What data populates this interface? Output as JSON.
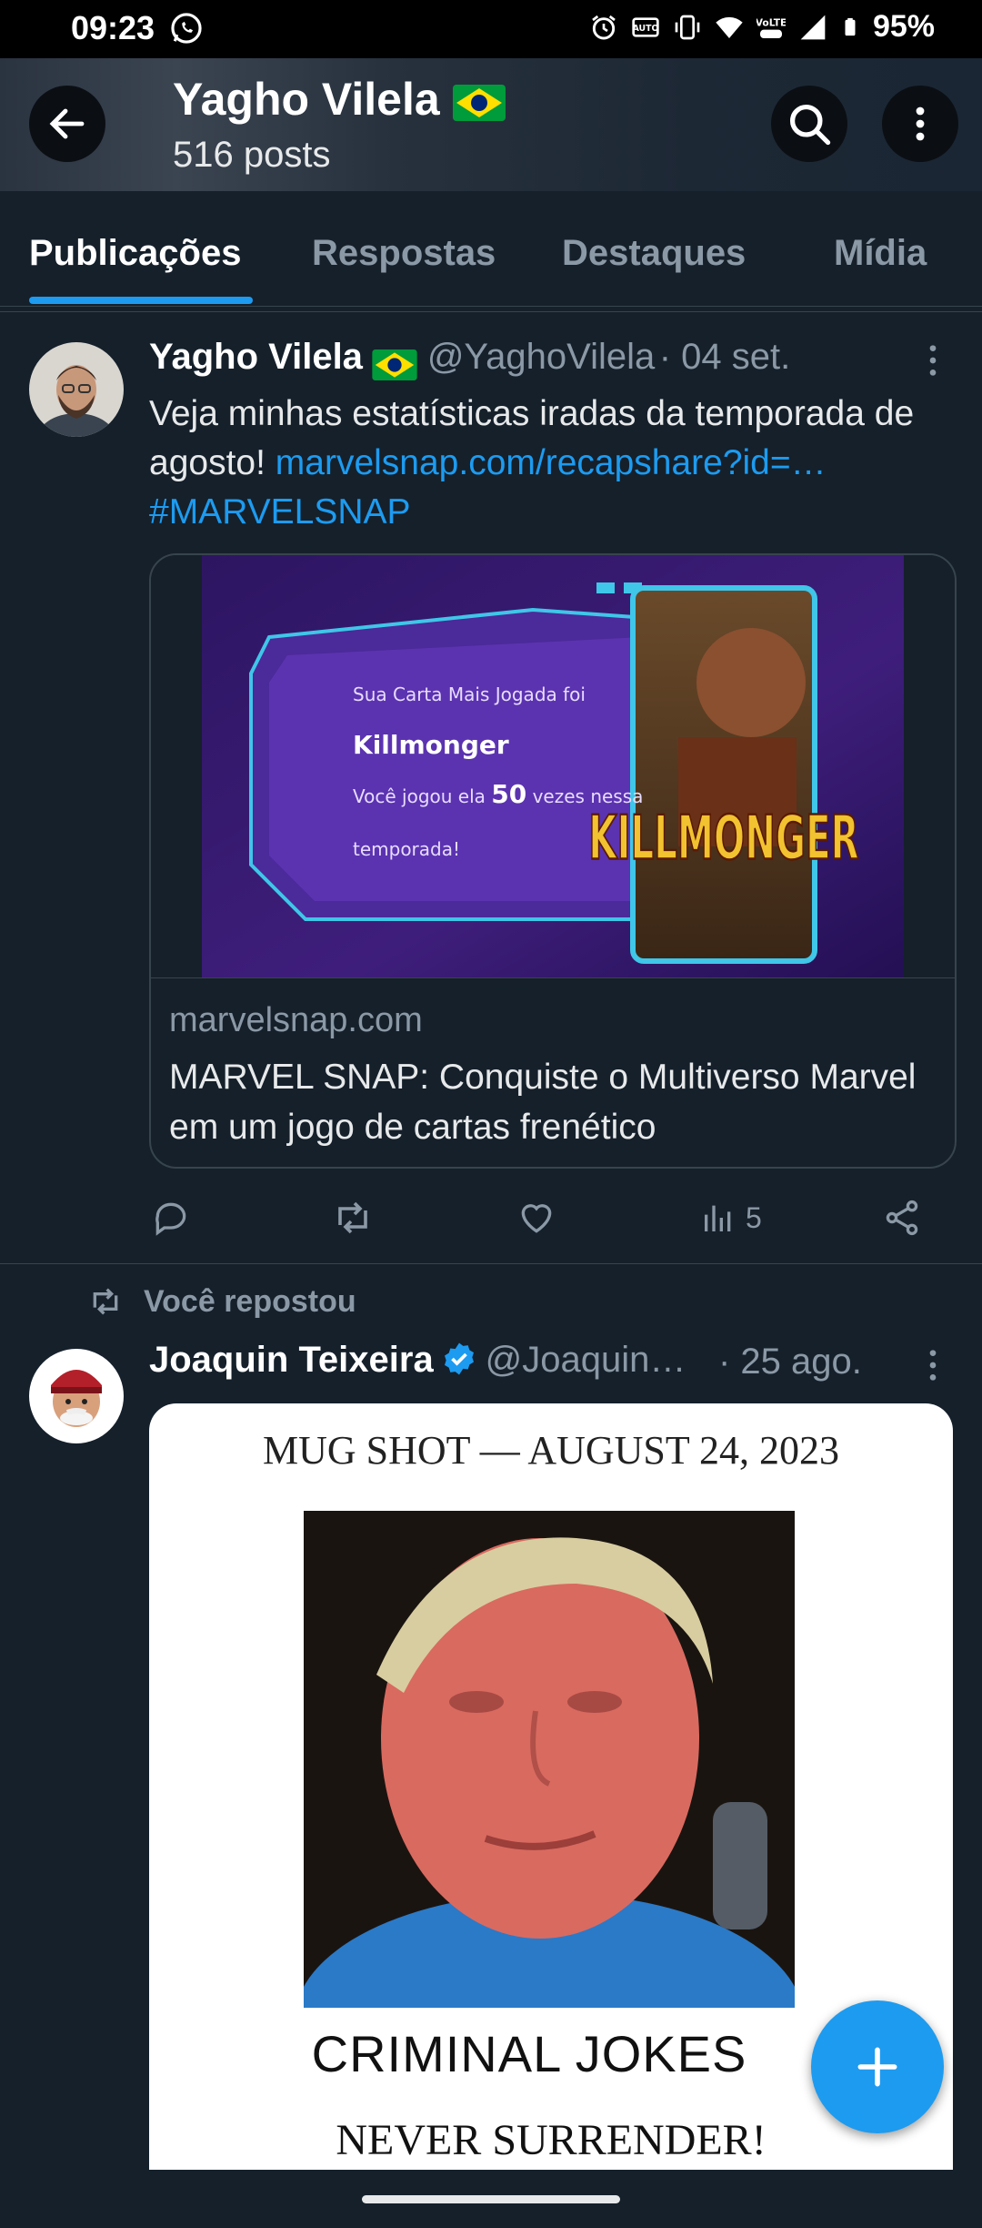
{
  "status_bar": {
    "time": "09:23",
    "battery": "95%"
  },
  "header": {
    "name": "Yagho Vilela",
    "posts": "516 posts"
  },
  "tabs": [
    {
      "label": "Publicações"
    },
    {
      "label": "Respostas"
    },
    {
      "label": "Destaques"
    },
    {
      "label": "Mídia"
    }
  ],
  "post1": {
    "name": "Yagho Vilela",
    "handle": "@YaghoVilela",
    "date": "· 04 set.",
    "text": "Veja minhas estatísticas iradas da temporada de agosto! ",
    "link": "marvelsnap.com/recapshare?id=…",
    "hashtag": "#MARVELSNAP",
    "card": {
      "line1": "Sua Carta Mais Jogada foi",
      "card_name": "Killmonger",
      "line2a": "Você jogou ela ",
      "count": "50",
      "line2b": " vezes nessa",
      "line3": "temporada!",
      "art_title": "KILLMONGER",
      "domain": "marvelsnap.com",
      "title": "MARVEL SNAP: Conquiste o Multiverso Marvel em um jogo de cartas frenético"
    },
    "views": "5"
  },
  "repost_label": "Você repostou",
  "post2": {
    "name": "Joaquin Teixeira",
    "handle": "@Joaquin…",
    "date": "· 25 ago.",
    "image": {
      "title": "MUG SHOT — AUGUST 24, 2023",
      "caption": "CRIMINAL JOKES",
      "subcaption": "NEVER SURRENDER!"
    }
  },
  "colors": {
    "background": "#15202b",
    "accent": "#1d9bf0",
    "muted": "#8b98a5",
    "verified": "#1d9bf0"
  },
  "icons": [
    "whatsapp-icon",
    "alarm-icon",
    "vibrate-icon",
    "wifi-icon",
    "signal-icon",
    "battery-icon",
    "back-arrow-icon",
    "search-icon",
    "more-vertical-icon",
    "reply-icon",
    "repost-icon",
    "like-icon",
    "views-icon",
    "share-icon",
    "verified-badge-icon",
    "plus-icon"
  ]
}
